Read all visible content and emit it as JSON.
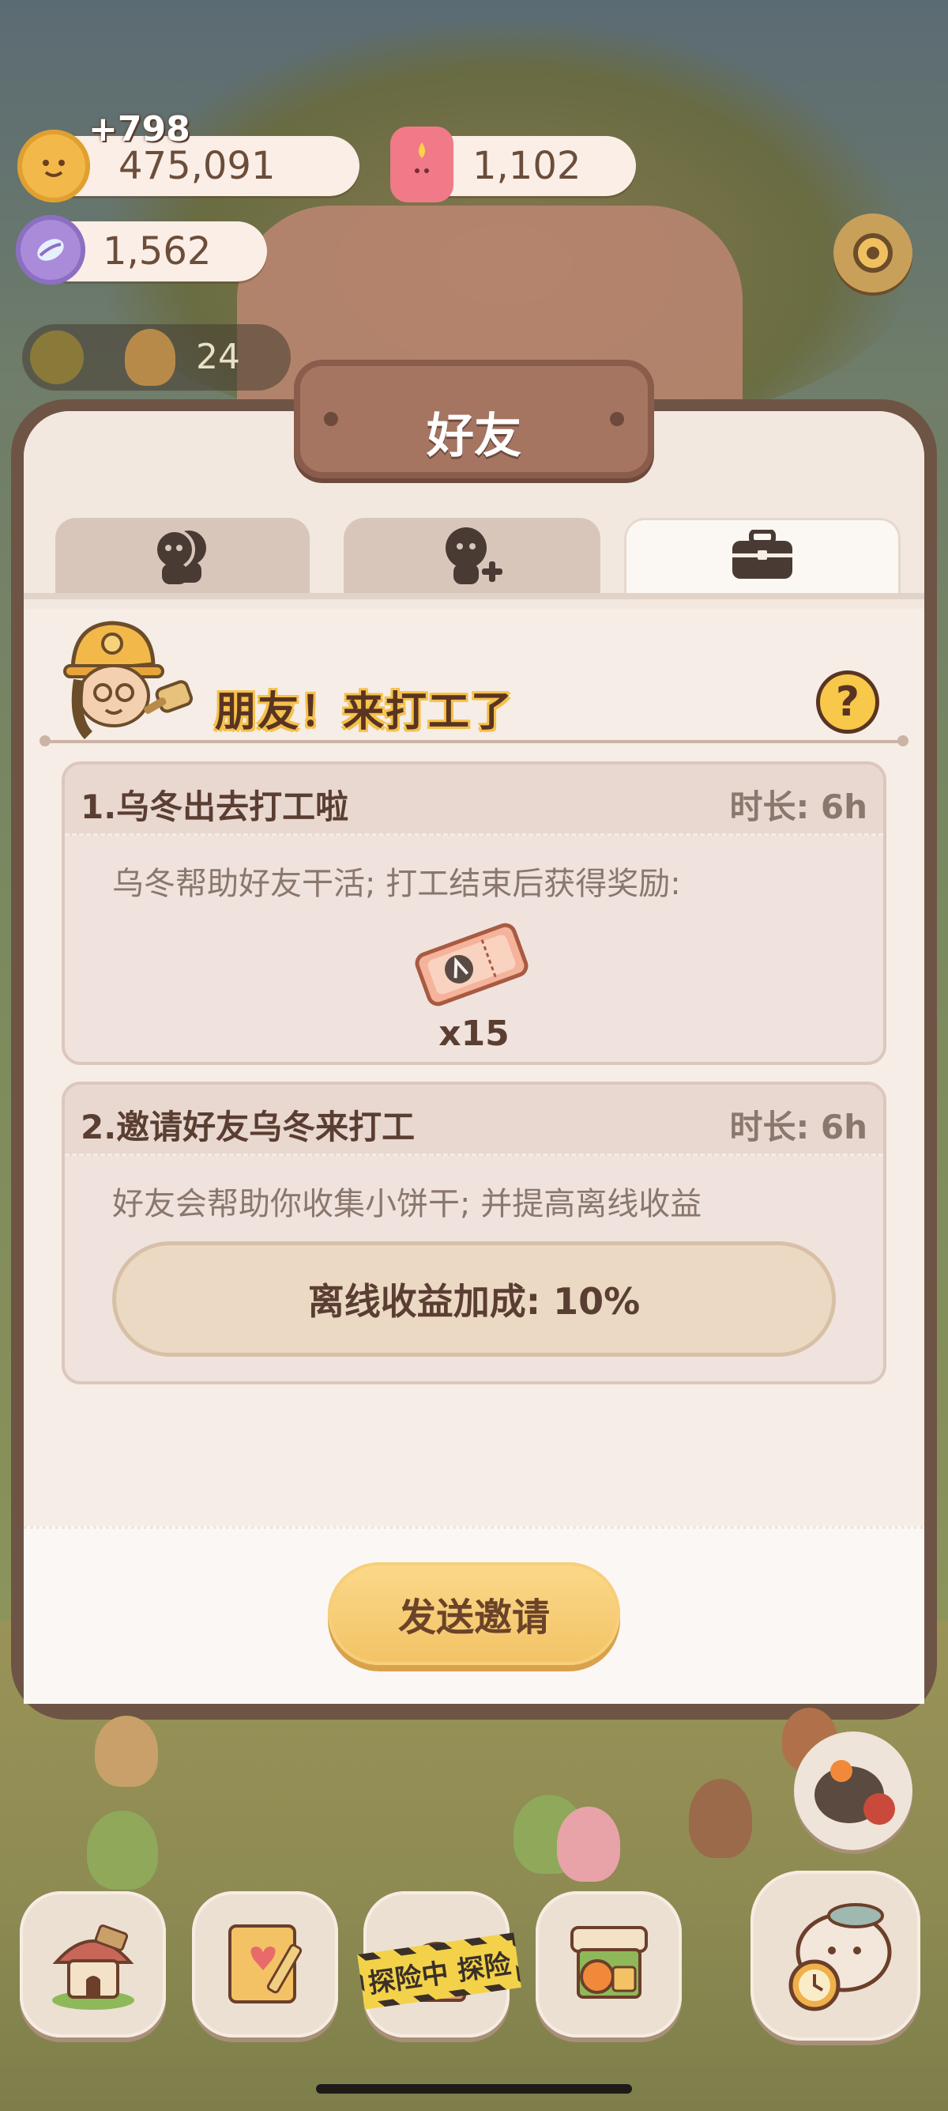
{
  "currencies": {
    "cookies": {
      "value": "475,091",
      "gain": "+798"
    },
    "candles": {
      "value": "1,102"
    },
    "gems": {
      "value": "1,562"
    }
  },
  "background": {
    "counter": "24"
  },
  "modal": {
    "title": "好友",
    "tabs": [
      {
        "icon": "friends-icon",
        "active": false
      },
      {
        "icon": "add-friend-icon",
        "active": false
      },
      {
        "icon": "briefcase-icon",
        "active": true
      }
    ],
    "header": {
      "title": "朋友！来打工了",
      "help_label": "?"
    },
    "cards": [
      {
        "title": "1.乌冬出去打工啦",
        "duration": "时长: 6h",
        "description": "乌冬帮助好友干活; 打工结束后获得奖励:",
        "reward_icon": "ticket-icon",
        "reward_qty": "x15"
      },
      {
        "title": "2.邀请好友乌冬来打工",
        "duration": "时长: 6h",
        "description": "好友会帮助你收集小饼干; 并提高离线收益",
        "bonus": "离线收益加成: 10%"
      }
    ],
    "send_button": "发送邀请"
  },
  "bottom_nav": {
    "items": [
      "house-icon",
      "notebook-icon",
      "expedition-icon",
      "shop-icon",
      "cat-clock-icon"
    ],
    "expedition_tape": "探险中 探险"
  },
  "colors": {
    "modal_bg": "#f6ede6",
    "modal_border": "#6e5444",
    "accent_yellow": "#f3c265",
    "text_brown": "#5a3e32",
    "muted_text": "#8a776d"
  }
}
